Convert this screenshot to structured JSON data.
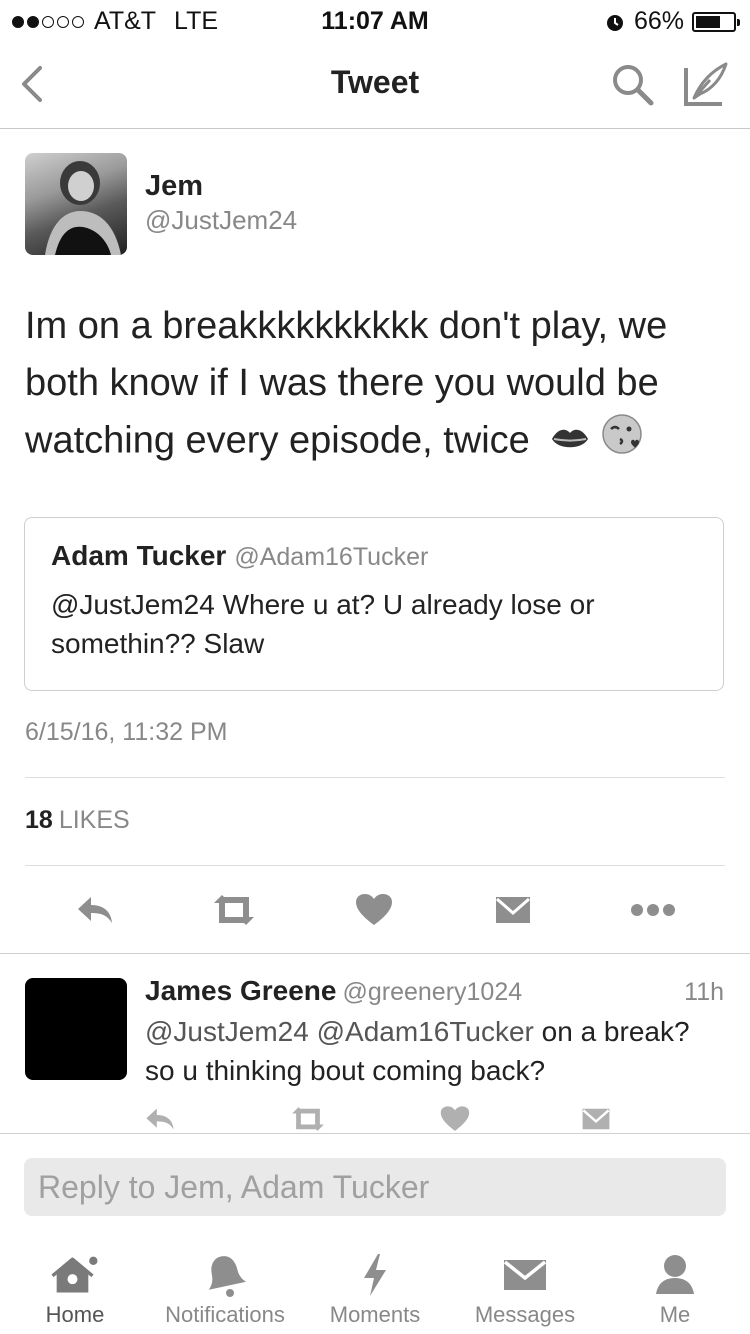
{
  "status_bar": {
    "carrier": "AT&T",
    "network": "LTE",
    "time": "11:07 AM",
    "battery_percent": "66%",
    "battery_level": 0.66,
    "signal_bars": 2,
    "signal_total": 5
  },
  "nav": {
    "title": "Tweet",
    "back_icon": "chevron-left-icon",
    "search_icon": "search-icon",
    "compose_icon": "compose-quill-icon"
  },
  "tweet": {
    "author_name": "Jem",
    "author_handle": "@JustJem24",
    "text": "Im on a breakkkkkkkkkk don't play, we both know if I was there you would be watching every episode, twice",
    "emojis": [
      "kiss-mark-icon",
      "face-blowing-kiss-icon"
    ],
    "quoted": {
      "name": "Adam Tucker",
      "handle": "@Adam16Tucker",
      "text": "@JustJem24 Where u at? U already lose or somethin?? Slaw"
    },
    "timestamp": "6/15/16, 11:32 PM",
    "likes_count": "18",
    "likes_label": "LIKES"
  },
  "reply": {
    "name": "James Greene",
    "handle": "@greenery1024",
    "time": "11h",
    "mention1": "@JustJem24",
    "mention2": "@Adam16Tucker",
    "text": "on a break? so u thinking bout coming back?"
  },
  "reply_input": {
    "placeholder": "Reply to Jem, Adam Tucker"
  },
  "tabs": [
    {
      "label": "Home",
      "icon": "home-icon"
    },
    {
      "label": "Notifications",
      "icon": "bell-icon"
    },
    {
      "label": "Moments",
      "icon": "lightning-icon"
    },
    {
      "label": "Messages",
      "icon": "envelope-icon"
    },
    {
      "label": "Me",
      "icon": "person-icon"
    }
  ],
  "colors": {
    "text": "#222222",
    "secondary": "#888888",
    "icon_gray": "#8e8e8e",
    "divider": "#dedede"
  }
}
